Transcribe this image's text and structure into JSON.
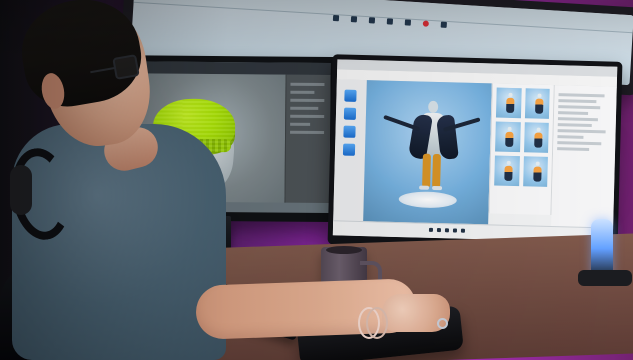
{
  "scene": {
    "subject": "",
    "accent_color": "#a432b3",
    "monitor_glow_color": "#6aa4ff"
  },
  "objects": {
    "top_monitor": "",
    "left_monitor": "",
    "right_monitor": "",
    "mug": "",
    "tablet": "",
    "keyboard": "",
    "speaker": ""
  },
  "icons": {
    "headphones": "headphones-icon",
    "glasses": "glasses-icon",
    "mug": "mug-icon",
    "monitor": "monitor-icon",
    "keyboard": "keyboard-icon",
    "tablet": "tablet-icon",
    "speaker": "speaker-icon"
  }
}
